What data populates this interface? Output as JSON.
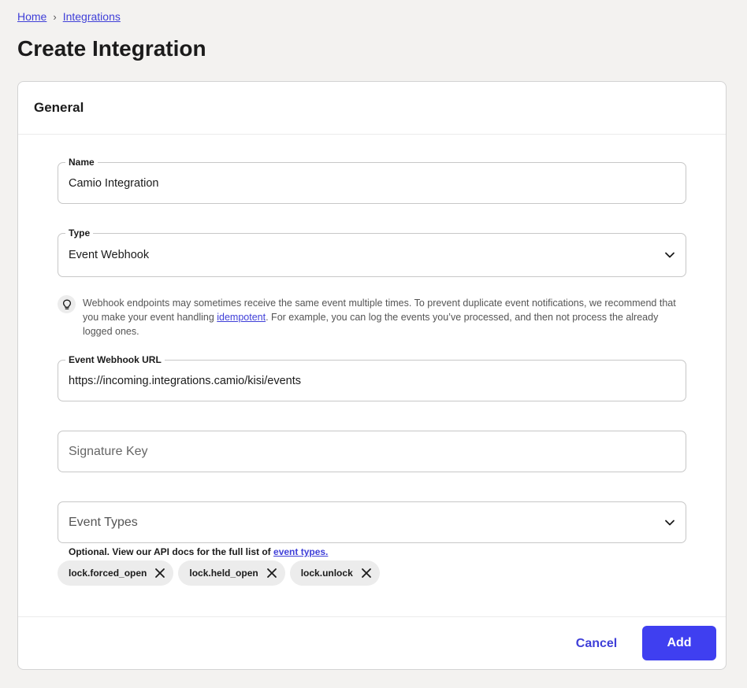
{
  "breadcrumb": {
    "home": "Home",
    "separator": "›",
    "current": "Integrations"
  },
  "page_title": "Create Integration",
  "section": {
    "title": "General"
  },
  "form": {
    "name": {
      "label": "Name",
      "value": "Camio Integration"
    },
    "type": {
      "label": "Type",
      "value": "Event Webhook"
    },
    "hint": {
      "icon": "lightbulb-icon",
      "text_before": "Webhook endpoints may sometimes receive the same event multiple times. To prevent duplicate event notifications, we recommend that you make your event handling ",
      "link": "idempotent",
      "text_after": ". For example, you can log the events you’ve processed, and then not process the already logged ones."
    },
    "webhook_url": {
      "label": "Event Webhook URL",
      "value": "https://incoming.integrations.camio/kisi/events"
    },
    "signature_key": {
      "placeholder": "Signature Key",
      "value": ""
    },
    "event_types": {
      "placeholder": "Event Types",
      "helper_text": "Optional. View our API docs for the full list of ",
      "helper_link": "event types.",
      "selected": [
        "lock.forced_open",
        "lock.held_open",
        "lock.unlock"
      ]
    }
  },
  "footer": {
    "cancel_label": "Cancel",
    "add_label": "Add"
  },
  "colors": {
    "accent": "#3f3ff0",
    "link": "#3f3fd8",
    "background": "#f3f2f0"
  }
}
